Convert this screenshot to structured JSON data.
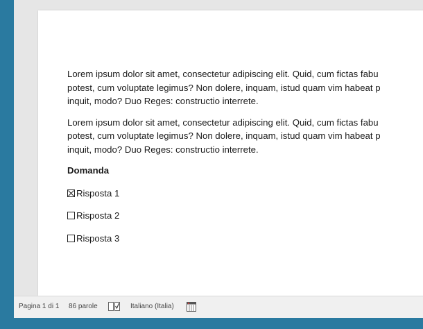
{
  "document": {
    "paragraphs": [
      "Lorem ipsum dolor sit amet, consectetur adipiscing elit. Quid, cum fictas fabu potest, cum voluptate legimus? Non dolere, inquam, istud quam vim habeat p inquit, modo? Duo Reges: constructio interrete.",
      "Lorem ipsum dolor sit amet, consectetur adipiscing elit. Quid, cum fictas fabu potest, cum voluptate legimus? Non dolere, inquam, istud quam vim habeat p inquit, modo? Duo Reges: constructio interrete."
    ],
    "paragraph_lines": [
      [
        "Lorem ipsum dolor sit amet, consectetur adipiscing elit. Quid, cum fictas fabu",
        "potest, cum voluptate legimus? Non dolere, inquam, istud quam vim habeat p",
        "inquit, modo? Duo Reges: constructio interrete."
      ],
      [
        "Lorem ipsum dolor sit amet, consectetur adipiscing elit. Quid, cum fictas fabu",
        "potest, cum voluptate legimus? Non dolere, inquam, istud quam vim habeat p",
        "inquit, modo? Duo Reges: constructio interrete."
      ]
    ],
    "question": "Domanda",
    "answers": [
      {
        "label": "Risposta 1",
        "checked": true
      },
      {
        "label": "Risposta 2",
        "checked": false
      },
      {
        "label": "Risposta 3",
        "checked": false
      }
    ]
  },
  "statusbar": {
    "page_info": "Pagina 1 di 1",
    "word_count": "86 parole",
    "proofing_icon": "spellcheck-icon",
    "language": "Italiano (Italia)",
    "macro_icon": "macro-record-icon"
  },
  "colors": {
    "desktop": "#2a7aa0",
    "workspace": "#e6e6e6",
    "page": "#ffffff"
  }
}
